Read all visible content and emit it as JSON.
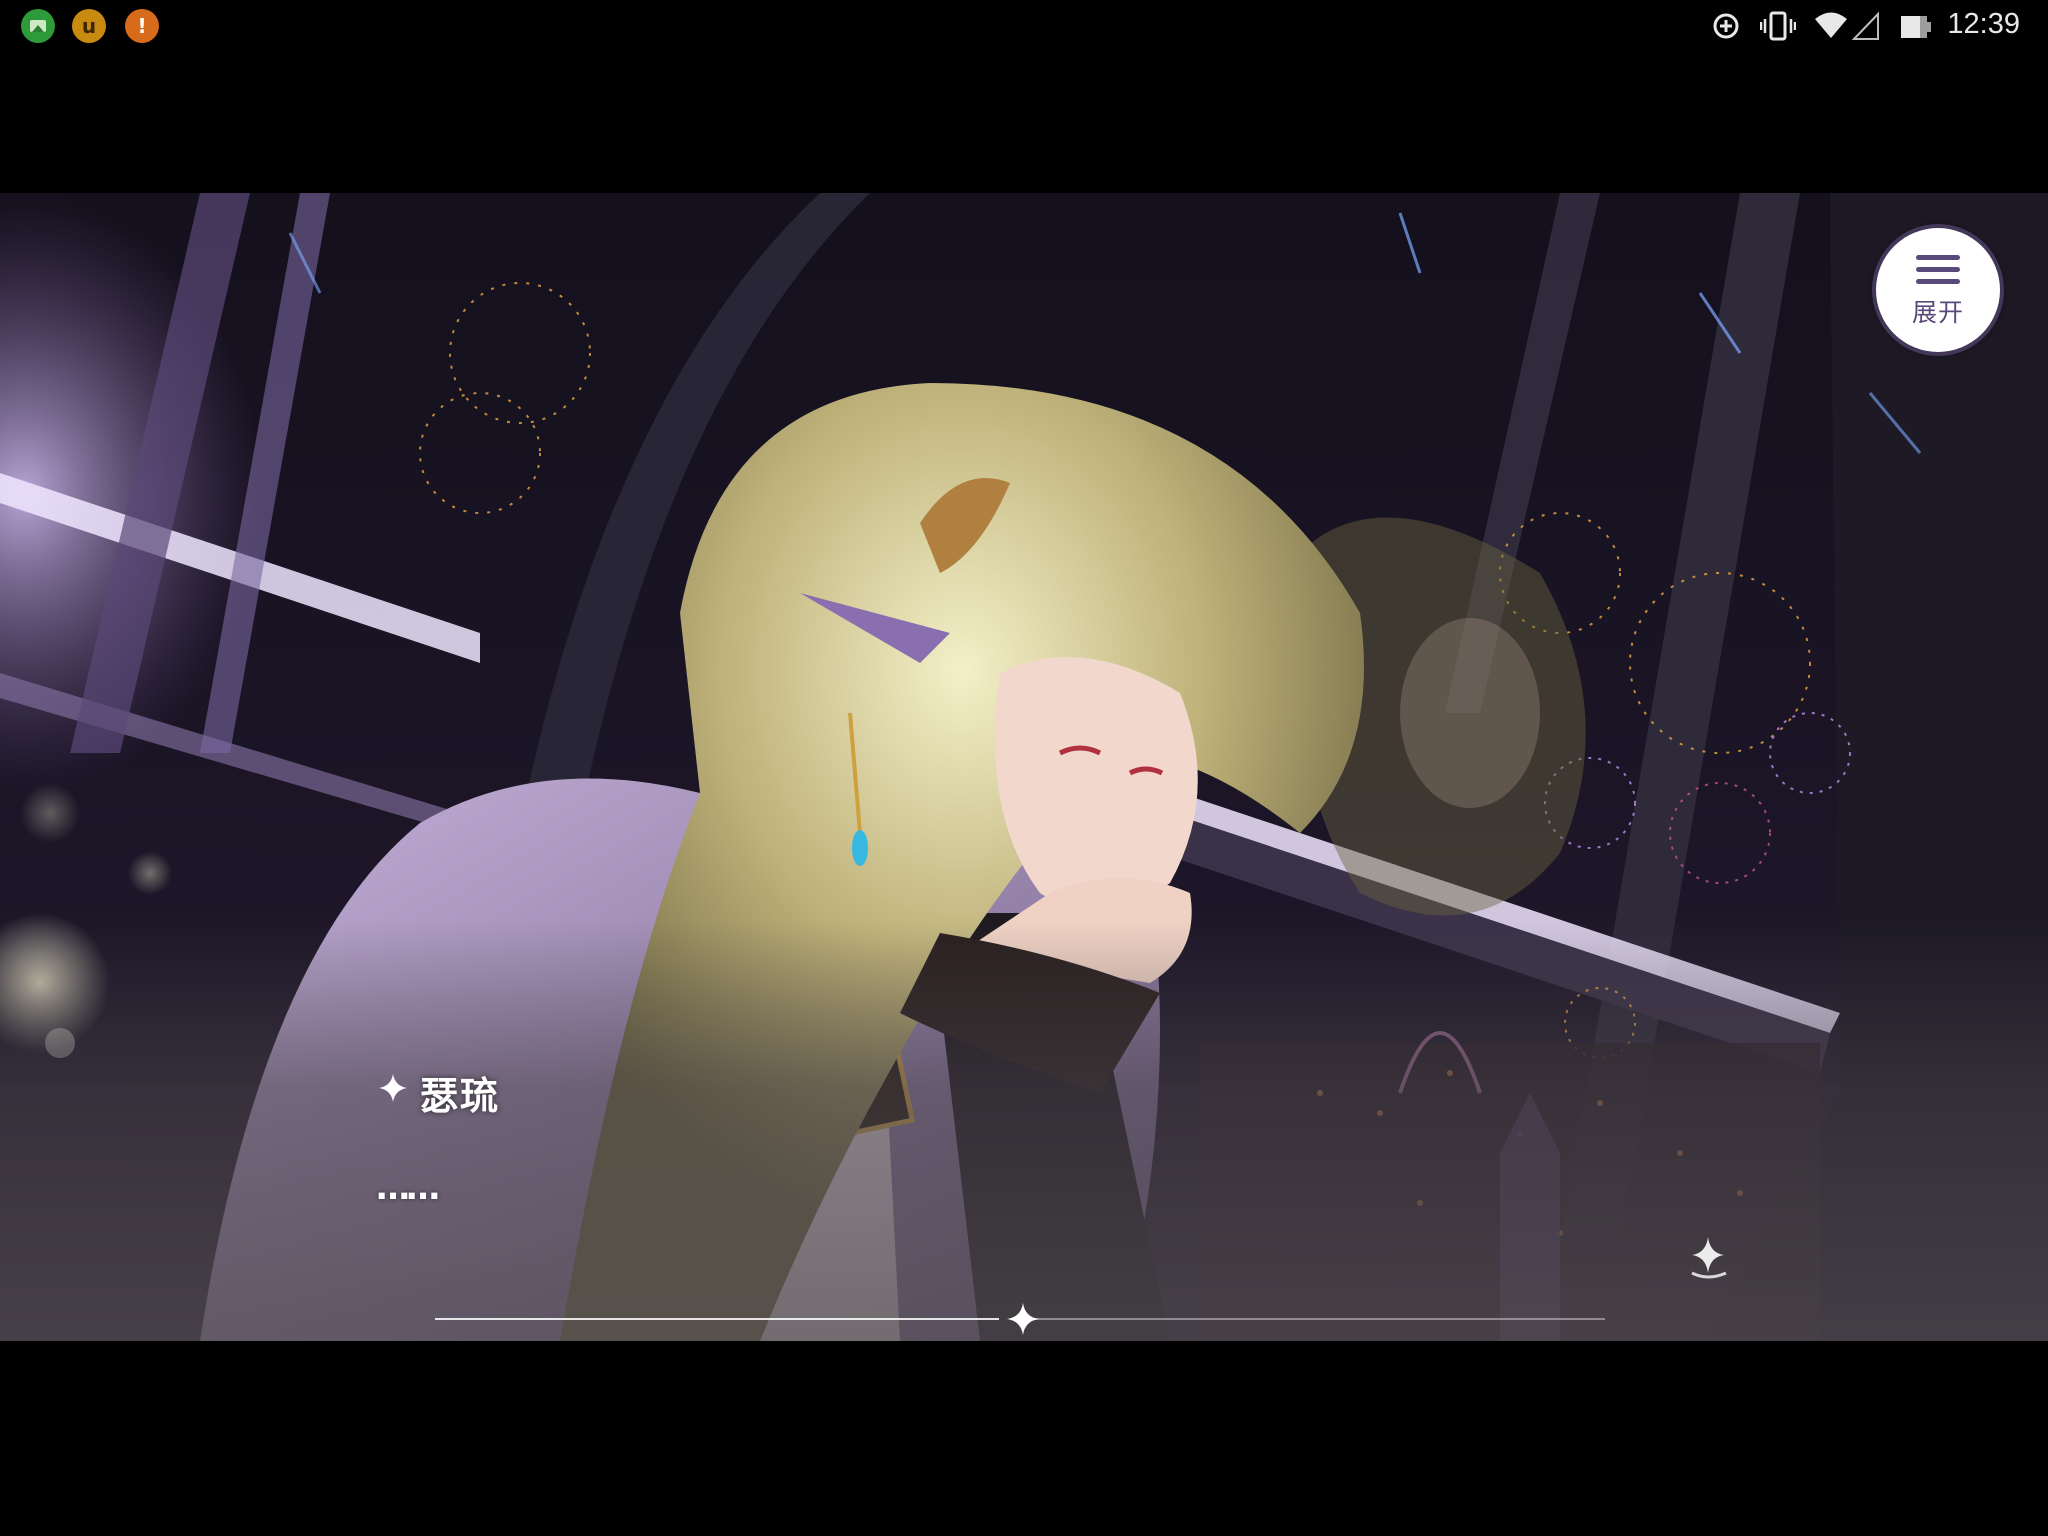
{
  "status_bar": {
    "notifications": [
      {
        "icon": "gallery-icon"
      },
      {
        "icon": "u-app-icon",
        "glyph": "u"
      },
      {
        "icon": "warning-icon",
        "glyph": "!"
      }
    ],
    "icons": [
      "data-saver-icon",
      "vibrate-icon",
      "wifi-icon",
      "no-signal-icon",
      "battery-icon"
    ],
    "time": "12:39"
  },
  "game": {
    "menu_button": {
      "label": "展开",
      "icon": "hamburger-menu-icon"
    },
    "dialogue": {
      "speaker": "瑟琉",
      "text": "……",
      "speaker_icon": "sparkle-icon"
    },
    "auto_button_icon": "sparkle-auto-icon",
    "colors": {
      "accent": "#5a4a7a",
      "text": "#ffffff",
      "button_bg": "#ffffff"
    }
  }
}
